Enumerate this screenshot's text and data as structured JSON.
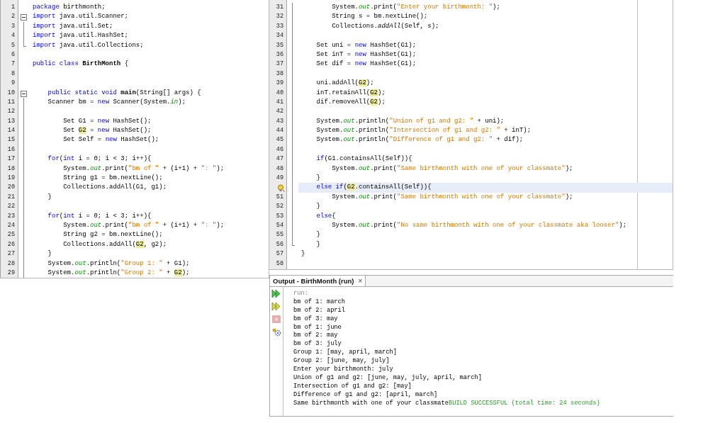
{
  "editor_left": {
    "lines": [
      {
        "number": "1",
        "kind": "plain",
        "segments": [
          {
            "kind": "keyword",
            "text": "package"
          },
          {
            "kind": "plain",
            "text": " birthmonth;"
          }
        ]
      },
      {
        "number": "2",
        "kind": "fold-start",
        "segments": [
          {
            "kind": "keyword",
            "text": "import"
          },
          {
            "kind": "plain",
            "text": " java.util.Scanner;"
          }
        ]
      },
      {
        "number": "3",
        "kind": "fold-body",
        "segments": [
          {
            "kind": "keyword",
            "text": "import"
          },
          {
            "kind": "plain",
            "text": " java.util.Set;"
          }
        ]
      },
      {
        "number": "4",
        "kind": "fold-body",
        "segments": [
          {
            "kind": "keyword",
            "text": "import"
          },
          {
            "kind": "plain",
            "text": " java.util.HashSet;"
          }
        ]
      },
      {
        "number": "5",
        "kind": "fold-end",
        "segments": [
          {
            "kind": "keyword",
            "text": "import"
          },
          {
            "kind": "plain",
            "text": " java.util.Collections;"
          }
        ]
      },
      {
        "number": "6",
        "kind": "plain"
      },
      {
        "number": "7",
        "kind": "plain",
        "segments": [
          {
            "kind": "keyword",
            "text": "public class "
          },
          {
            "kind": "bold",
            "text": "BirthMonth"
          },
          {
            "kind": "plain",
            "text": " {"
          }
        ]
      },
      {
        "number": "8",
        "kind": "plain"
      },
      {
        "number": "9",
        "kind": "plain"
      },
      {
        "number": "10",
        "kind": "fold-start",
        "segments": [
          {
            "kind": "keyword",
            "text": "    public static void "
          },
          {
            "kind": "bold",
            "text": "main"
          },
          {
            "kind": "plain",
            "text": "(String[] args) {"
          }
        ]
      },
      {
        "number": "11",
        "kind": "fold-body",
        "segments": [
          {
            "kind": "plain",
            "text": "    Scanner bm = "
          },
          {
            "kind": "keyword",
            "text": "new"
          },
          {
            "kind": "plain",
            "text": " Scanner(System."
          },
          {
            "kind": "field",
            "text": "in"
          },
          {
            "kind": "plain",
            "text": ");"
          }
        ]
      },
      {
        "number": "12",
        "kind": "fold-body"
      },
      {
        "number": "13",
        "kind": "fold-body",
        "segments": [
          {
            "kind": "plain",
            "text": "        Set G1 = "
          },
          {
            "kind": "keyword",
            "text": "new"
          },
          {
            "kind": "plain",
            "text": " HashSet();"
          }
        ]
      },
      {
        "number": "14",
        "kind": "fold-body",
        "segments": [
          {
            "kind": "plain",
            "text": "        Set "
          },
          {
            "kind": "highlight",
            "text": "G2"
          },
          {
            "kind": "plain",
            "text": " = "
          },
          {
            "kind": "keyword",
            "text": "new"
          },
          {
            "kind": "plain",
            "text": " HashSet();"
          }
        ]
      },
      {
        "number": "15",
        "kind": "fold-body",
        "segments": [
          {
            "kind": "plain",
            "text": "        Set Self = "
          },
          {
            "kind": "keyword",
            "text": "new"
          },
          {
            "kind": "plain",
            "text": " HashSet();"
          }
        ]
      },
      {
        "number": "16",
        "kind": "fold-body"
      },
      {
        "number": "17",
        "kind": "fold-body",
        "segments": [
          {
            "kind": "keyword",
            "text": "    for"
          },
          {
            "kind": "plain",
            "text": "("
          },
          {
            "kind": "keyword",
            "text": "int"
          },
          {
            "kind": "plain",
            "text": " i = 0; i < 3; i++){"
          }
        ]
      },
      {
        "number": "18",
        "kind": "fold-body",
        "segments": [
          {
            "kind": "plain",
            "text": "        System."
          },
          {
            "kind": "field",
            "text": "out"
          },
          {
            "kind": "plain",
            "text": ".print("
          },
          {
            "kind": "string",
            "text": "\"bm of \""
          },
          {
            "kind": "plain",
            "text": " + (i+1) + "
          },
          {
            "kind": "string",
            "text": "\": \""
          },
          {
            "kind": "plain",
            "text": ");"
          }
        ]
      },
      {
        "number": "19",
        "kind": "fold-body",
        "segments": [
          {
            "kind": "plain",
            "text": "        String g1 = bm.nextLine();"
          }
        ]
      },
      {
        "number": "20",
        "kind": "fold-body",
        "segments": [
          {
            "kind": "plain",
            "text": "        Collections.addAll(G1, g1);"
          }
        ]
      },
      {
        "number": "21",
        "kind": "fold-body",
        "segments": [
          {
            "kind": "plain",
            "text": "    }"
          }
        ]
      },
      {
        "number": "22",
        "kind": "fold-body"
      },
      {
        "number": "23",
        "kind": "fold-body",
        "segments": [
          {
            "kind": "keyword",
            "text": "    for"
          },
          {
            "kind": "plain",
            "text": "("
          },
          {
            "kind": "keyword",
            "text": "int"
          },
          {
            "kind": "plain",
            "text": " i = 0; i < 3; i++){"
          }
        ]
      },
      {
        "number": "24",
        "kind": "fold-body",
        "segments": [
          {
            "kind": "plain",
            "text": "        System."
          },
          {
            "kind": "field",
            "text": "out"
          },
          {
            "kind": "plain",
            "text": ".print("
          },
          {
            "kind": "string",
            "text": "\"bm of \""
          },
          {
            "kind": "plain",
            "text": " + (i+1) + "
          },
          {
            "kind": "string",
            "text": "\": \""
          },
          {
            "kind": "plain",
            "text": ");"
          }
        ]
      },
      {
        "number": "25",
        "kind": "fold-body",
        "segments": [
          {
            "kind": "plain",
            "text": "        String g2 = bm.nextLine();"
          }
        ]
      },
      {
        "number": "26",
        "kind": "fold-body",
        "segments": [
          {
            "kind": "plain",
            "text": "        Collections.addAll("
          },
          {
            "kind": "highlight",
            "text": "G2"
          },
          {
            "kind": "plain",
            "text": ", g2);"
          }
        ]
      },
      {
        "number": "27",
        "kind": "fold-body",
        "segments": [
          {
            "kind": "plain",
            "text": "    }"
          }
        ]
      },
      {
        "number": "28",
        "kind": "fold-body",
        "segments": [
          {
            "kind": "plain",
            "text": "    System."
          },
          {
            "kind": "field",
            "text": "out"
          },
          {
            "kind": "plain",
            "text": ".println("
          },
          {
            "kind": "string",
            "text": "\"Group 1: \""
          },
          {
            "kind": "plain",
            "text": " + G1);"
          }
        ]
      },
      {
        "number": "29",
        "kind": "fold-body",
        "segments": [
          {
            "kind": "plain",
            "text": "    System."
          },
          {
            "kind": "field",
            "text": "out"
          },
          {
            "kind": "plain",
            "text": ".println("
          },
          {
            "kind": "string",
            "text": "\"Group 2: \""
          },
          {
            "kind": "plain",
            "text": " + "
          },
          {
            "kind": "highlight",
            "text": "G2"
          },
          {
            "kind": "plain",
            "text": ");"
          }
        ]
      }
    ]
  },
  "editor_right": {
    "lines": [
      {
        "number": "31",
        "kind": "fold-body",
        "segments": [
          {
            "kind": "plain",
            "text": "        System."
          },
          {
            "kind": "field",
            "text": "out"
          },
          {
            "kind": "plain",
            "text": ".print("
          },
          {
            "kind": "string",
            "text": "\"Enter your birthmonth: \""
          },
          {
            "kind": "plain",
            "text": ");"
          }
        ]
      },
      {
        "number": "32",
        "kind": "fold-body",
        "segments": [
          {
            "kind": "plain",
            "text": "        String s = bm.nextLine();"
          }
        ]
      },
      {
        "number": "33",
        "kind": "fold-body",
        "segments": [
          {
            "kind": "plain",
            "text": "        Collections."
          },
          {
            "kind": "italic",
            "text": "addAll"
          },
          {
            "kind": "plain",
            "text": "(Self, s);"
          }
        ]
      },
      {
        "number": "34",
        "kind": "fold-body"
      },
      {
        "number": "35",
        "kind": "fold-body",
        "segments": [
          {
            "kind": "plain",
            "text": "    Set uni = "
          },
          {
            "kind": "keyword",
            "text": "new"
          },
          {
            "kind": "plain",
            "text": " HashSet(G1);"
          }
        ]
      },
      {
        "number": "36",
        "kind": "fold-body",
        "segments": [
          {
            "kind": "plain",
            "text": "    Set inT = "
          },
          {
            "kind": "keyword",
            "text": "new"
          },
          {
            "kind": "plain",
            "text": " HashSet(G1);"
          }
        ]
      },
      {
        "number": "37",
        "kind": "fold-body",
        "segments": [
          {
            "kind": "plain",
            "text": "    Set dif = "
          },
          {
            "kind": "keyword",
            "text": "new"
          },
          {
            "kind": "plain",
            "text": " HashSet(G1);"
          }
        ]
      },
      {
        "number": "38",
        "kind": "fold-body"
      },
      {
        "number": "39",
        "kind": "fold-body",
        "segments": [
          {
            "kind": "plain",
            "text": "    uni.addAll("
          },
          {
            "kind": "highlight",
            "text": "G2"
          },
          {
            "kind": "plain",
            "text": ");"
          }
        ]
      },
      {
        "number": "40",
        "kind": "fold-body",
        "segments": [
          {
            "kind": "plain",
            "text": "    inT.retainAll("
          },
          {
            "kind": "highlight",
            "text": "G2"
          },
          {
            "kind": "plain",
            "text": ");"
          }
        ]
      },
      {
        "number": "41",
        "kind": "fold-body",
        "segments": [
          {
            "kind": "plain",
            "text": "    dif.removeAll("
          },
          {
            "kind": "highlight",
            "text": "G2"
          },
          {
            "kind": "plain",
            "text": ");"
          }
        ]
      },
      {
        "number": "42",
        "kind": "fold-body"
      },
      {
        "number": "43",
        "kind": "fold-body",
        "segments": [
          {
            "kind": "plain",
            "text": "    System."
          },
          {
            "kind": "field",
            "text": "out"
          },
          {
            "kind": "plain",
            "text": ".println("
          },
          {
            "kind": "string",
            "text": "\"Union of g1 and g2: \""
          },
          {
            "kind": "plain",
            "text": " + uni);"
          }
        ]
      },
      {
        "number": "44",
        "kind": "fold-body",
        "segments": [
          {
            "kind": "plain",
            "text": "    System."
          },
          {
            "kind": "field",
            "text": "out"
          },
          {
            "kind": "plain",
            "text": ".println("
          },
          {
            "kind": "string",
            "text": "\"Intersection of g1 and g2: \""
          },
          {
            "kind": "plain",
            "text": " + inT);"
          }
        ]
      },
      {
        "number": "45",
        "kind": "fold-body",
        "segments": [
          {
            "kind": "plain",
            "text": "    System."
          },
          {
            "kind": "field",
            "text": "out"
          },
          {
            "kind": "plain",
            "text": ".println("
          },
          {
            "kind": "string",
            "text": "\"Difference of g1 and g2: \""
          },
          {
            "kind": "plain",
            "text": " + dif);"
          }
        ]
      },
      {
        "number": "46",
        "kind": "fold-body"
      },
      {
        "number": "47",
        "kind": "fold-body",
        "segments": [
          {
            "kind": "keyword",
            "text": "    if"
          },
          {
            "kind": "plain",
            "text": "(G1.containsAll(Self)){"
          }
        ]
      },
      {
        "number": "48",
        "kind": "fold-body",
        "segments": [
          {
            "kind": "plain",
            "text": "        System."
          },
          {
            "kind": "field",
            "text": "out"
          },
          {
            "kind": "plain",
            "text": ".print("
          },
          {
            "kind": "string",
            "text": "\"Same birthmonth with one of your classmate\""
          },
          {
            "kind": "plain",
            "text": ");"
          }
        ]
      },
      {
        "number": "49",
        "kind": "fold-body",
        "segments": [
          {
            "kind": "plain",
            "text": "    }"
          }
        ]
      },
      {
        "hint": true,
        "current": true,
        "kind": "fold-body",
        "segments": [
          {
            "kind": "keyword",
            "text": "    else if"
          },
          {
            "kind": "plain",
            "text": "("
          },
          {
            "kind": "highlight",
            "text": "G2"
          },
          {
            "kind": "plain",
            "text": ".containsAll(Self)){"
          }
        ]
      },
      {
        "number": "51",
        "kind": "fold-body",
        "segments": [
          {
            "kind": "plain",
            "text": "        System."
          },
          {
            "kind": "field",
            "text": "out"
          },
          {
            "kind": "plain",
            "text": ".print("
          },
          {
            "kind": "string",
            "text": "\"Same birthmonth with one of your classmate\""
          },
          {
            "kind": "plain",
            "text": ");"
          }
        ]
      },
      {
        "number": "52",
        "kind": "fold-body",
        "segments": [
          {
            "kind": "plain",
            "text": "    }"
          }
        ]
      },
      {
        "number": "53",
        "kind": "fold-body",
        "segments": [
          {
            "kind": "keyword",
            "text": "    else"
          },
          {
            "kind": "plain",
            "text": "{"
          }
        ]
      },
      {
        "number": "54",
        "kind": "fold-body",
        "segments": [
          {
            "kind": "plain",
            "text": "        System."
          },
          {
            "kind": "field",
            "text": "out"
          },
          {
            "kind": "plain",
            "text": ".print("
          },
          {
            "kind": "string",
            "text": "\"No same birthmonth with one of your classmate aka looser\""
          },
          {
            "kind": "plain",
            "text": ");"
          }
        ]
      },
      {
        "number": "55",
        "kind": "fold-body",
        "segments": [
          {
            "kind": "plain",
            "text": "    }"
          }
        ]
      },
      {
        "number": "56",
        "kind": "fold-end",
        "segments": [
          {
            "kind": "plain",
            "text": "    }"
          }
        ]
      },
      {
        "number": "57",
        "kind": "plain",
        "segments": [
          {
            "kind": "plain",
            "text": "}"
          }
        ]
      },
      {
        "number": "58",
        "kind": "plain"
      }
    ]
  },
  "output": {
    "tab": {
      "label": "Output - BirthMonth (run)",
      "close": "×",
      "selected": true
    },
    "tools": [
      {
        "kind": "rerun",
        "disabled": false
      },
      {
        "kind": "rerun-alt",
        "disabled": false
      },
      {
        "kind": "stop",
        "disabled": true
      },
      {
        "kind": "settings",
        "disabled": false
      }
    ],
    "lines": [
      {
        "segments": [
          {
            "kind": "muted",
            "text": "run:"
          }
        ]
      },
      {
        "segments": [
          {
            "kind": "plain",
            "text": "bm of 1: march"
          }
        ]
      },
      {
        "segments": [
          {
            "kind": "plain",
            "text": "bm of 2: april"
          }
        ]
      },
      {
        "segments": [
          {
            "kind": "plain",
            "text": "bm of 3: may"
          }
        ]
      },
      {
        "segments": [
          {
            "kind": "plain",
            "text": "bm of 1: june"
          }
        ]
      },
      {
        "segments": [
          {
            "kind": "plain",
            "text": "bm of 2: may"
          }
        ]
      },
      {
        "segments": [
          {
            "kind": "plain",
            "text": "bm of 3: july"
          }
        ]
      },
      {
        "segments": [
          {
            "kind": "plain",
            "text": "Group 1: [may, april, march]"
          }
        ]
      },
      {
        "segments": [
          {
            "kind": "plain",
            "text": "Group 2: [june, may, july]"
          }
        ]
      },
      {
        "segments": [
          {
            "kind": "plain",
            "text": "Enter your birthmonth: july"
          }
        ]
      },
      {
        "segments": [
          {
            "kind": "plain",
            "text": "Union of g1 and g2: [june, may, july, april, march]"
          }
        ]
      },
      {
        "segments": [
          {
            "kind": "plain",
            "text": "Intersection of g1 and g2: [may]"
          }
        ]
      },
      {
        "segments": [
          {
            "kind": "plain",
            "text": "Difference of g1 and g2: [april, march]"
          }
        ]
      },
      {
        "segments": [
          {
            "kind": "plain",
            "text": "Same birthmonth with one of your classmate"
          },
          {
            "kind": "success",
            "text": "BUILD SUCCESSFUL (total time: 24 seconds)"
          }
        ]
      }
    ]
  }
}
